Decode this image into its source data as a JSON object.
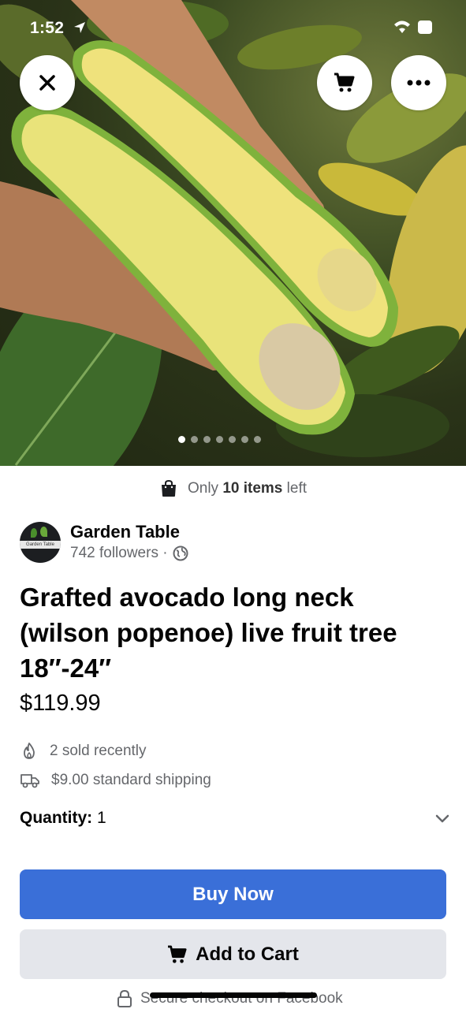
{
  "status_bar": {
    "time": "1:52"
  },
  "hero": {
    "image_count": 7,
    "active_image_index": 0
  },
  "stock": {
    "prefix": "Only",
    "count": "10 items",
    "suffix": "left"
  },
  "seller": {
    "name": "Garden Table",
    "followers": "742 followers ·",
    "avatar_text": "Garden Table"
  },
  "listing": {
    "title": "Grafted avocado long neck (wilson popenoe) live fruit tree 18″-24″",
    "price": "$119.99",
    "sold": "2 sold recently",
    "shipping": "$9.00 standard shipping"
  },
  "quantity": {
    "label": "Quantity:",
    "value": "1"
  },
  "actions": {
    "buy_now": "Buy Now",
    "add_to_cart": "Add to Cart"
  },
  "footer": {
    "secure": "Secure checkout on Facebook"
  },
  "colors": {
    "primary": "#3a6fd8",
    "secondary_bg": "#e4e6eb",
    "muted_text": "#65676b"
  },
  "icons": {
    "close": "close-icon",
    "cart": "cart-icon",
    "more": "more-icon",
    "bag": "shopping-bag-icon",
    "globe": "globe-icon",
    "flame": "flame-icon",
    "truck": "truck-icon",
    "chevron": "chevron-down-icon",
    "lock": "lock-icon"
  }
}
